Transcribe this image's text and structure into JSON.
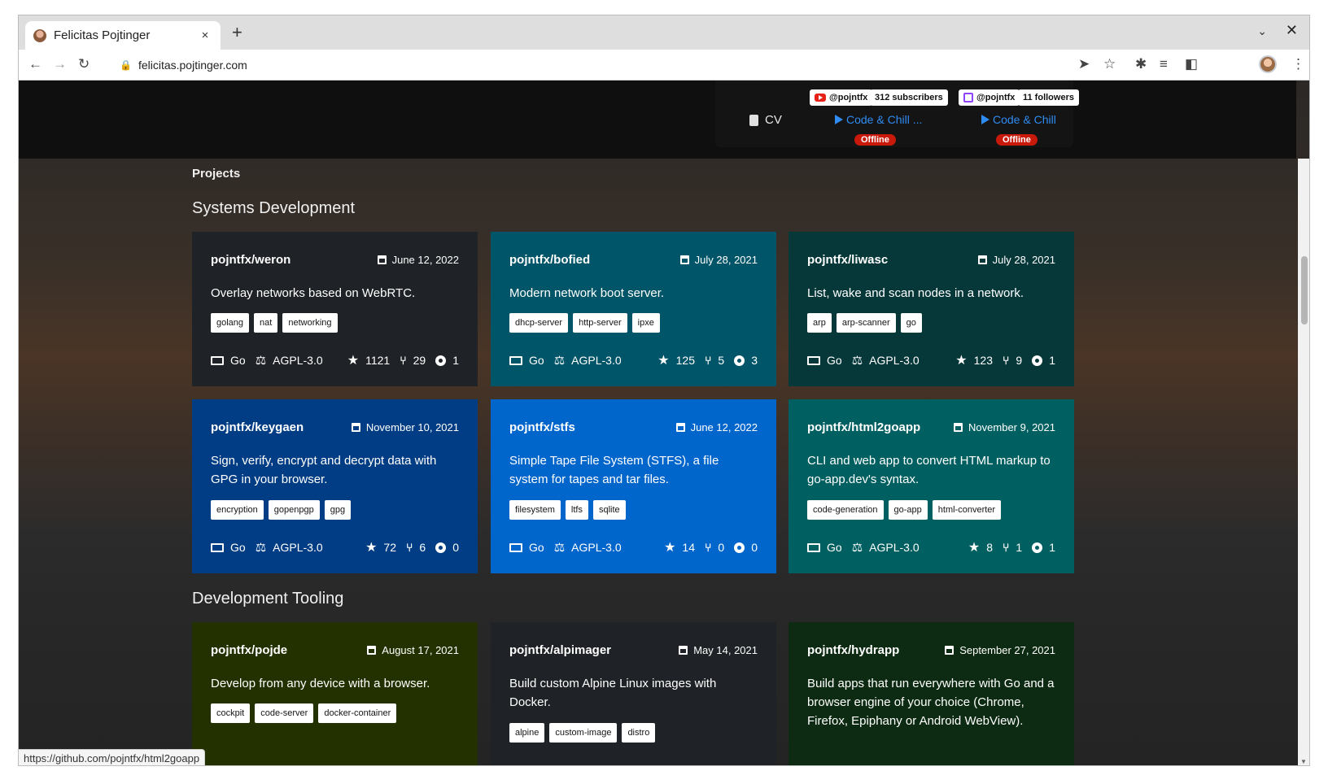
{
  "browser": {
    "tab_title": "Felicitas Pojtinger",
    "close_tab": "×",
    "new_tab": "+",
    "tab_menu": "⌄",
    "window_close": "✕",
    "url": "felicitas.pojtinger.com",
    "back": "←",
    "forward": "→",
    "reload": "↻",
    "share": "➤",
    "bookmark": "☆",
    "extensions": "✱",
    "media": "≡",
    "sidepanel": "◧",
    "menu": "⋮"
  },
  "hero": {
    "cv_label": "CV",
    "youtube": {
      "handle": "@pojntfx",
      "count": "312 subscribers",
      "stream_title": "Code & Chill ...",
      "status": "Offline"
    },
    "twitch": {
      "handle": "@pojntfx",
      "count": "11 followers",
      "stream_title": "Code & Chill",
      "status": "Offline"
    }
  },
  "main": {
    "projects_label": "Projects",
    "sections": [
      {
        "title": "Systems Development"
      },
      {
        "title": "Development Tooling"
      }
    ],
    "cards": [
      {
        "name": "pojntfx/weron",
        "date": "June 12, 2022",
        "desc": "Overlay networks based on WebRTC.",
        "tags": [
          "golang",
          "nat",
          "networking"
        ],
        "lang": "Go",
        "license": "AGPL-3.0",
        "stars": "1121",
        "forks": "29",
        "issues": "1",
        "bg": "#1f2226"
      },
      {
        "name": "pojntfx/bofied",
        "date": "July 28, 2021",
        "desc": "Modern network boot server.",
        "tags": [
          "dhcp-server",
          "http-server",
          "ipxe"
        ],
        "lang": "Go",
        "license": "AGPL-3.0",
        "stars": "125",
        "forks": "5",
        "issues": "3",
        "bg": "#005568"
      },
      {
        "name": "pojntfx/liwasc",
        "date": "July 28, 2021",
        "desc": "List, wake and scan nodes in a network.",
        "tags": [
          "arp",
          "arp-scanner",
          "go"
        ],
        "lang": "Go",
        "license": "AGPL-3.0",
        "stars": "123",
        "forks": "9",
        "issues": "1",
        "bg": "#06383a"
      },
      {
        "name": "pojntfx/keygaen",
        "date": "November 10, 2021",
        "desc": "Sign, verify, encrypt and decrypt data with GPG in your browser.",
        "tags": [
          "encryption",
          "gopenpgp",
          "gpg"
        ],
        "lang": "Go",
        "license": "AGPL-3.0",
        "stars": "72",
        "forks": "6",
        "issues": "0",
        "bg": "#003d84"
      },
      {
        "name": "pojntfx/stfs",
        "date": "June 12, 2022",
        "desc": "Simple Tape File System (STFS), a file system for tapes and tar files.",
        "tags": [
          "filesystem",
          "ltfs",
          "sqlite"
        ],
        "lang": "Go",
        "license": "AGPL-3.0",
        "stars": "14",
        "forks": "0",
        "issues": "0",
        "bg": "#0066cc"
      },
      {
        "name": "pojntfx/html2goapp",
        "date": "November 9, 2021",
        "desc": "CLI and web app to convert HTML markup to go-app.dev's syntax.",
        "tags": [
          "code-generation",
          "go-app",
          "html-converter"
        ],
        "lang": "Go",
        "license": "AGPL-3.0",
        "stars": "8",
        "forks": "1",
        "issues": "1",
        "bg": "#005f60"
      },
      {
        "name": "pojntfx/pojde",
        "date": "August 17, 2021",
        "desc": "Develop from any device with a browser.",
        "tags": [
          "cockpit",
          "code-server",
          "docker-container"
        ],
        "bg": "#233100"
      },
      {
        "name": "pojntfx/alpimager",
        "date": "May 14, 2021",
        "desc": "Build custom Alpine Linux images with Docker.",
        "tags": [
          "alpine",
          "custom-image",
          "distro"
        ],
        "bg": "#1f2226"
      },
      {
        "name": "pojntfx/hydrapp",
        "date": "September 27, 2021",
        "desc": "Build apps that run everywhere with Go and a browser engine of your choice (Chrome, Firefox, Epiphany or Android WebView).",
        "tags": [],
        "bg": "#0c2b12"
      }
    ]
  },
  "status_url": "https://github.com/pojntfx/html2goapp"
}
